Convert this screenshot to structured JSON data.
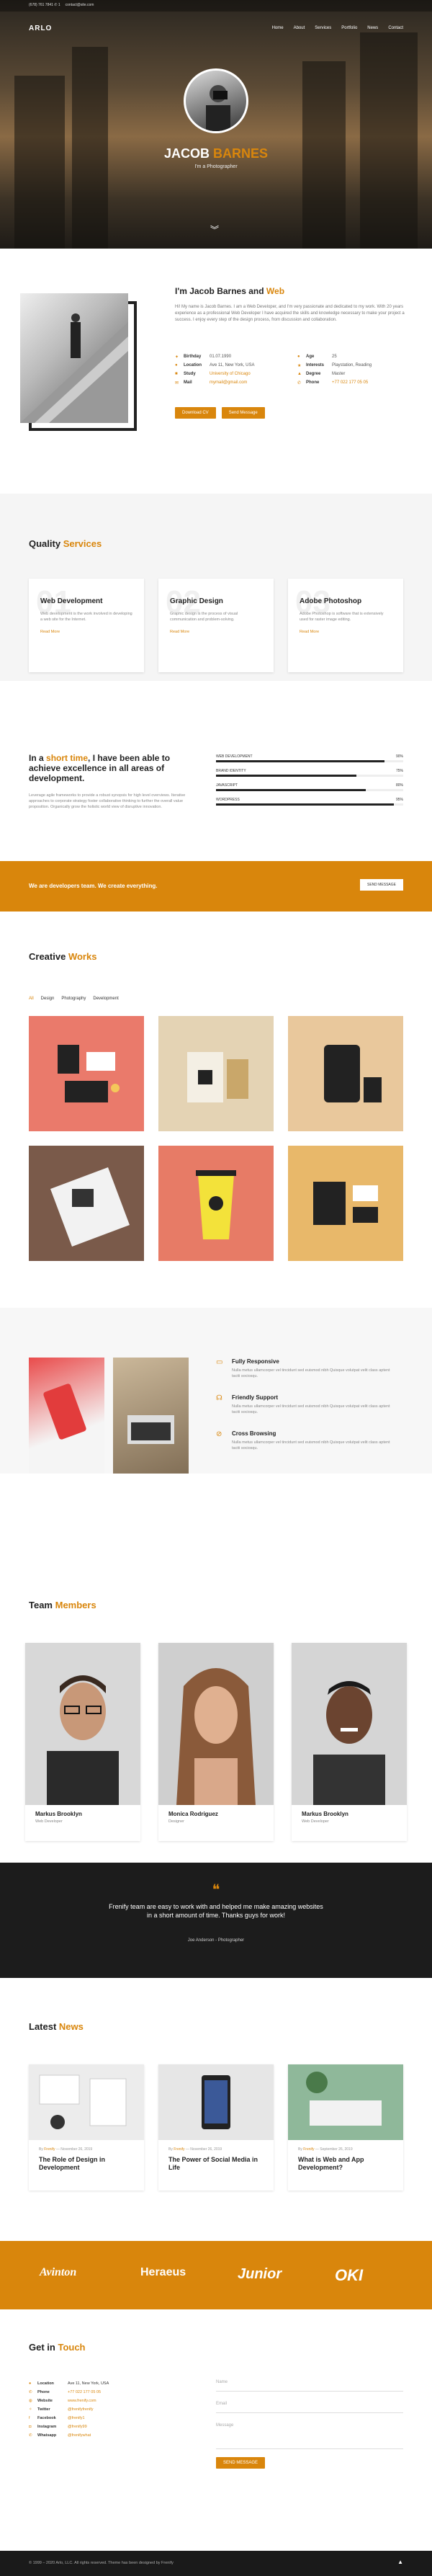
{
  "topbar": {
    "phone": "(678) 761 7841 ✆ 1",
    "email": "contact@site.com"
  },
  "nav": {
    "logo": "ARLO",
    "items": [
      "Home",
      "About",
      "Services",
      "Portfolio",
      "News",
      "Contact"
    ]
  },
  "hero": {
    "name_first": "JACOB",
    "name_last": "BARNES",
    "subtitle": "I'm a Photographer",
    "scroll_icon": "chevron-double-down"
  },
  "about": {
    "title_prefix": "I'm Jacob Barnes and",
    "title_highlight": "Web",
    "text": "Hi! My name is Jacob Barnes. I am a Web Developer, and I'm very passionate and dedicated to my work. With 20 years experience as a professional Web Developer I have acquired the skills and knowledge necessary to make your project a success. I enjoy every step of the design process, from discussion and collaboration.",
    "info": [
      {
        "icon": "gift",
        "k": "Birthday",
        "v": "01.07.1990"
      },
      {
        "icon": "map-pin",
        "k": "Location",
        "v": "Ave 11, New York, USA"
      },
      {
        "icon": "book",
        "k": "Study",
        "v": "University of Chicago"
      },
      {
        "icon": "envelope",
        "k": "Mail",
        "v": "mymail@gmail.com"
      },
      {
        "icon": "user",
        "k": "Age",
        "v": "25"
      },
      {
        "icon": "star",
        "k": "Interests",
        "v": "Playstation, Reading"
      },
      {
        "icon": "graduation",
        "k": "Degree",
        "v": "Master"
      },
      {
        "icon": "phone",
        "k": "Phone",
        "v": "+77 022 177 05 05"
      }
    ],
    "btn_download": "Download CV",
    "btn_message": "Send Message"
  },
  "services": {
    "title_a": "Quality",
    "title_b": "Services",
    "cards": [
      {
        "num": "01",
        "title": "Web Development",
        "desc": "Web development is the work involved in developing a web site for the Internet.",
        "link": "Read More"
      },
      {
        "num": "02",
        "title": "Graphic Design",
        "desc": "Graphic design is the process of visual communication and problem-solving.",
        "link": "Read More"
      },
      {
        "num": "03",
        "title": "Adobe Photoshop",
        "desc": "Adobe Photoshop is software that is extensively used for raster image editing.",
        "link": "Read More"
      }
    ]
  },
  "skills": {
    "title_a": "In a",
    "title_b": "short time",
    "title_c": ", I have been able to achieve excellence in all areas of development.",
    "text": "Leverage agile frameworks to provide a robust synopsis for high level overviews. Iterative approaches to corporate strategy foster collaborative thinking to further the overall value proposition. Organically grow the holistic world view of disruptive innovation.",
    "bars": [
      {
        "label": "WEB DEVELOPMENT",
        "pct": "90%",
        "value": 0.9
      },
      {
        "label": "BRAND IDENTITY",
        "pct": "75%",
        "value": 0.75
      },
      {
        "label": "JAVASCRIPT",
        "pct": "80%",
        "value": 0.8
      },
      {
        "label": "WORDPRESS",
        "pct": "95%",
        "value": 0.95
      }
    ]
  },
  "cta": {
    "text": "We are developers team. We create everything.",
    "button": "SEND MESSAGE"
  },
  "works": {
    "title_a": "Creative",
    "title_b": "Works",
    "filters": [
      "All",
      "Design",
      "Photography",
      "Development"
    ]
  },
  "features": [
    {
      "icon": "desktop",
      "title": "Fully Responsive",
      "desc": "Nulla metus ullamcorper vel tincidunt sed euismod nibh Quisque volutpat velit class aptent taciti sociosqu."
    },
    {
      "icon": "headset",
      "title": "Friendly Support",
      "desc": "Nulla metus ullamcorper vel tincidunt sed euismod nibh Quisque volutpat velit class aptent taciti sociosqu."
    },
    {
      "icon": "compass",
      "title": "Cross Browsing",
      "desc": "Nulla metus ullamcorper vel tincidunt sed euismod nibh Quisque volutpat velit class aptent taciti sociosqu."
    }
  ],
  "team": {
    "title_a": "Team",
    "title_b": "Members",
    "members": [
      {
        "name": "Markus Brooklyn",
        "role": "Web Developer"
      },
      {
        "name": "Monica Rodriguez",
        "role": "Designer"
      },
      {
        "name": "Markus Brooklyn",
        "role": "Web Developer"
      }
    ]
  },
  "quote": {
    "mark": "❝",
    "text": "Frenify team are easy to work with and helped me make amazing websites in a short amount of time. Thanks guys for work!",
    "author": "Joe Anderson - Photographer"
  },
  "news": {
    "title_a": "Latest",
    "title_b": "News",
    "posts": [
      {
        "by": "By",
        "author": "Frenify",
        "date": "November 26, 2019",
        "title": "The Role of Design in Development"
      },
      {
        "by": "By",
        "author": "Frenify",
        "date": "November 26, 2019",
        "title": "The Power of Social Media in Life"
      },
      {
        "by": "By",
        "author": "Frenify",
        "date": "September 26, 2019",
        "title": "What is Web and App Development?"
      }
    ]
  },
  "brands": [
    "Avinton",
    "Heraeus",
    "Junior",
    "OKI"
  ],
  "contact": {
    "title_a": "Get in",
    "title_b": "Touch",
    "info": [
      {
        "icon": "map-pin",
        "k": "Location",
        "v": "Ave 11, New York, USA"
      },
      {
        "icon": "phone",
        "k": "Phone",
        "v": "+77 022 177 05 05"
      },
      {
        "icon": "globe",
        "k": "Website",
        "v": "www.frenify.com"
      },
      {
        "icon": "twitter",
        "k": "Twitter",
        "v": "@frenifyfrenify"
      },
      {
        "icon": "facebook",
        "k": "Facebook",
        "v": "@frenify1"
      },
      {
        "icon": "instagram",
        "k": "Instagram",
        "v": "@frenify99"
      },
      {
        "icon": "whatsapp",
        "k": "Whatsapp",
        "v": "@frenifywhat"
      }
    ],
    "fields": [
      "Name",
      "Email",
      "Message"
    ],
    "button": "SEND MESSAGE"
  },
  "footer": {
    "text": "© 1999 – 2020 Arlo, LLC. All rights reserved. Theme has been designed by Frenify",
    "totop": "▲"
  },
  "colors": {
    "accent": "#d9860c",
    "dark": "#1c1c1c"
  }
}
